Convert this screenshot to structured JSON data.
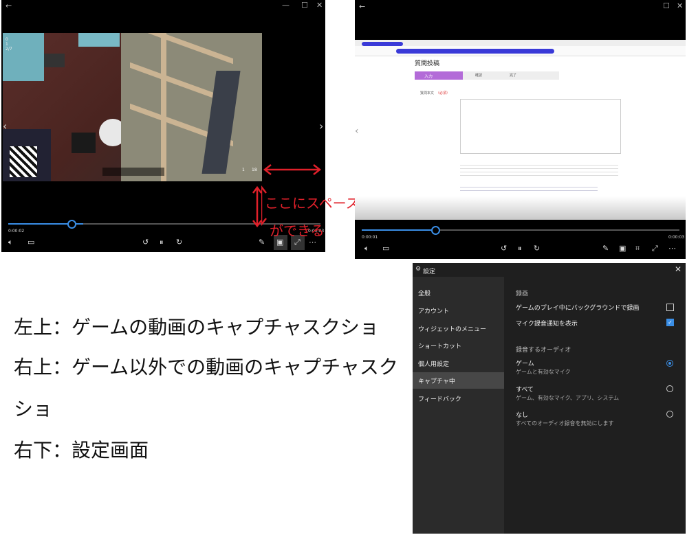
{
  "left_player": {
    "back_icon": "back-arrow-icon",
    "window_controls": [
      "—",
      "☐",
      "✕"
    ],
    "hud_lines": [
      "0",
      "1",
      "2/7"
    ],
    "hud_counter": "1",
    "hud_counter2": "18",
    "time_current": "0:00:02",
    "time_total": "0:00:03",
    "progress": 0.24
  },
  "annotation": {
    "text_line1": "ここにスペース",
    "text_line2": "ができる",
    "color": "#e0202a"
  },
  "right_player": {
    "page_title": "質問投稿",
    "steps": [
      "入力",
      "確認",
      "完了"
    ],
    "field_label": "質問本文",
    "required": "（必須）",
    "time_current": "0:00:01",
    "time_total": "0:00:03",
    "progress": 0.24
  },
  "settings": {
    "title": "設定",
    "nav": [
      "全般",
      "アカウント",
      "ウィジェットのメニュー",
      "ショートカット",
      "個人用設定",
      "キャプチャ中",
      "フィードバック"
    ],
    "selected_index": 5,
    "section_recording": "録画",
    "bg_record_label": "ゲームのプレイ中にバックグラウンドで録画",
    "bg_record_checked": false,
    "mic_notify_label": "マイク録音通知を表示",
    "mic_notify_checked": true,
    "section_audio": "録音するオーディオ",
    "audio_options": [
      {
        "title": "ゲーム",
        "desc": "ゲームと有効なマイク",
        "selected": true
      },
      {
        "title": "すべて",
        "desc": "ゲーム、有効なマイク、アプリ、システム",
        "selected": false
      },
      {
        "title": "なし",
        "desc": "すべてのオーディオ録音を無効にします",
        "selected": false
      }
    ],
    "accent": "#3a8ee6"
  },
  "captions": {
    "line1": "左上：ゲームの動画のキャプチャスクショ",
    "line2a": "右上：ゲーム以外での動画のキャプチャスク",
    "line2b": "ショ",
    "line3": "右下：設定画面"
  }
}
